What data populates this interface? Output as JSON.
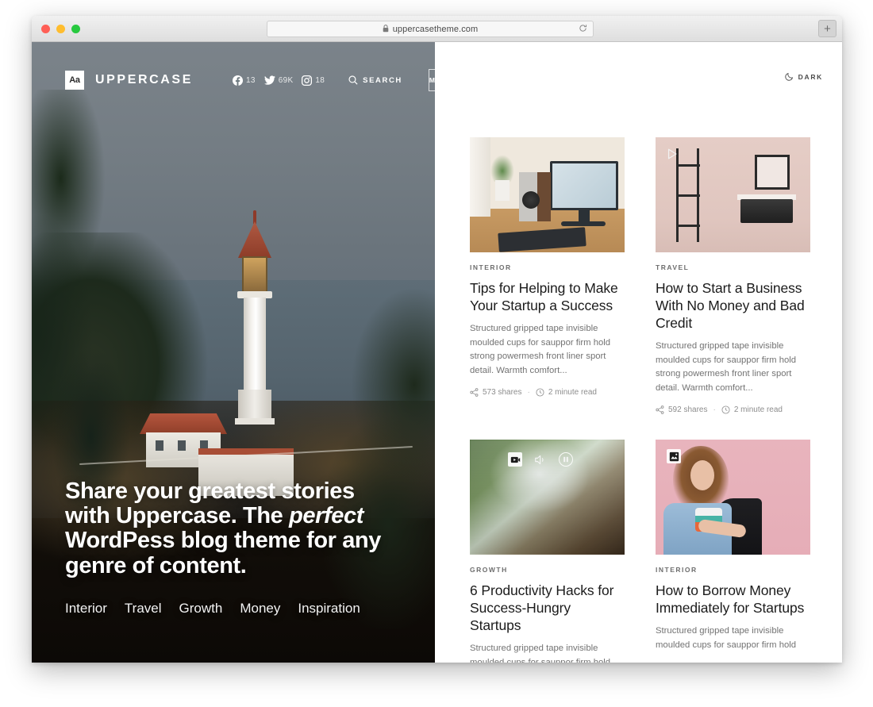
{
  "browser": {
    "url": "uppercasetheme.com",
    "lock_icon": "lock-icon",
    "reload_icon": "reload-icon",
    "newtab_label": "+",
    "traffic_lights": [
      "close",
      "minimize",
      "maximize"
    ]
  },
  "site": {
    "logo_mark": "Aa",
    "logo_text": "UPPERCASE",
    "social": [
      {
        "icon": "facebook-icon",
        "count": "13"
      },
      {
        "icon": "twitter-icon",
        "count": "69K"
      },
      {
        "icon": "instagram-icon",
        "count": "18"
      }
    ],
    "search_label": "SEARCH",
    "menu_label": "MENU",
    "dark_label": "DARK",
    "dark_icon": "moon-icon"
  },
  "hero": {
    "title_line1": "Share your greatest stories",
    "title_line2_a": "with Uppercase. The ",
    "title_line2_em": "perfect",
    "title_line3": "WordPess blog theme for any",
    "title_line4": "genre of content.",
    "categories": [
      "Interior",
      "Travel",
      "Growth",
      "Money",
      "Inspiration"
    ]
  },
  "posts": [
    {
      "category": "INTERIOR",
      "title": "Tips for Helping to Make Your Startup a Success",
      "excerpt": "Structured gripped tape invisible moulded cups for sauppor firm hold strong powermesh front liner sport detail. Warmth comfort...",
      "shares": "573 shares",
      "read_time": "2 minute read",
      "separator": "·",
      "badges": [],
      "thumb": "desk-workspace-photo"
    },
    {
      "category": "TRAVEL",
      "title": "How to Start a Business With No Money and Bad Credit",
      "excerpt": "Structured gripped tape invisible moulded cups for sauppor firm hold strong powermesh front liner sport detail. Warmth comfort...",
      "shares": "592 shares",
      "read_time": "2 minute read",
      "separator": "·",
      "badges": [
        "play-icon"
      ],
      "thumb": "bathroom-interior-photo"
    },
    {
      "category": "GROWTH",
      "title": "6 Productivity Hacks for Success-Hungry Startups",
      "excerpt": "Structured gripped tape invisible moulded cups for sauppor firm hold",
      "shares": "",
      "read_time": "",
      "separator": "",
      "badges": [
        "video-icon",
        "audio-icon",
        "pause-icon"
      ],
      "thumb": "blurred-foliage-photo"
    },
    {
      "category": "INTERIOR",
      "title": "How to Borrow Money Immediately for Startups",
      "excerpt": "Structured gripped tape invisible moulded cups for sauppor firm hold",
      "shares": "",
      "read_time": "",
      "separator": "",
      "badges": [
        "gallery-icon"
      ],
      "thumb": "woman-pink-background-photo"
    }
  ],
  "icons": {
    "share": "share-icon",
    "clock": "clock-icon"
  },
  "colors": {
    "page_bg": "#ffffff",
    "text_primary": "#1b1b1b",
    "text_muted": "#737373",
    "meta": "#8d8d8d",
    "category": "#6d6d6d",
    "hero_text": "#ffffff"
  }
}
